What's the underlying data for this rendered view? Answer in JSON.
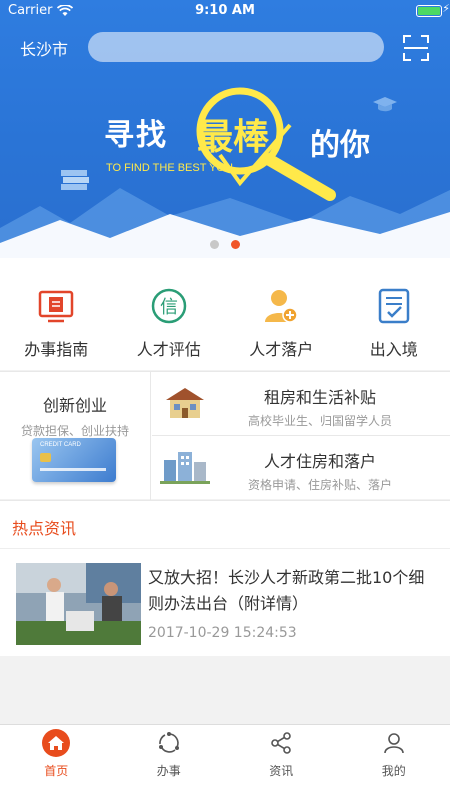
{
  "status_bar": {
    "carrier": "Carrier",
    "time": "9:10 AM"
  },
  "header": {
    "city": "长沙市",
    "search": {
      "placeholder": "",
      "value": ""
    }
  },
  "banner": {
    "prefix": "寻找",
    "highlight": "最棒",
    "suffix": "的你",
    "subtitle": "TO FIND THE BEST YOU",
    "dots": 2,
    "active_dot": 1
  },
  "quick_menu": [
    {
      "label": "办事指南",
      "icon": "document-screen-icon",
      "color": "#e2452a"
    },
    {
      "label": "人才评估",
      "icon": "xin-circle-icon",
      "color": "#2a9d76"
    },
    {
      "label": "人才落户",
      "icon": "person-add-icon",
      "color": "#f0a330"
    },
    {
      "label": "出入境",
      "icon": "checklist-icon",
      "color": "#3a7ec9"
    }
  ],
  "feature_cards": {
    "left": {
      "title": "创新创业",
      "subtitle": "贷款担保、创业扶持",
      "card_text": "CREDIT CARD",
      "icon": "credit-card-icon"
    },
    "right": [
      {
        "title": "租房和生活补贴",
        "subtitle": "高校毕业生、归国留学人员",
        "icon": "house-icon"
      },
      {
        "title": "人才住房和落户",
        "subtitle": "资格申请、住房补贴、落户",
        "icon": "buildings-icon"
      }
    ]
  },
  "news": {
    "section_title": "热点资讯",
    "items": [
      {
        "title": "又放大招！长沙人才新政第二批10个细则办法出台（附详情）",
        "time": "2017-10-29 15:24:53"
      }
    ]
  },
  "tabbar": {
    "items": [
      {
        "label": "首页",
        "icon": "home-icon",
        "active": true
      },
      {
        "label": "办事",
        "icon": "process-icon",
        "active": false
      },
      {
        "label": "资讯",
        "icon": "share-icon",
        "active": false
      },
      {
        "label": "我的",
        "icon": "user-icon",
        "active": false
      }
    ]
  },
  "colors": {
    "primary_blue": "#2f7de0",
    "accent_orange": "#e84c1d",
    "banner_yellow": "#ffe94a"
  }
}
